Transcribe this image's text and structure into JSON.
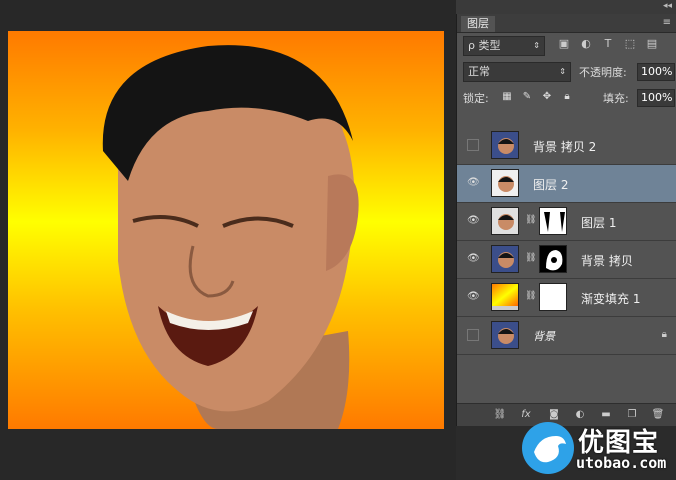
{
  "panel": {
    "collapse_icon": "double-chevron-icon",
    "tab_label": "图层",
    "filter": {
      "label": "ρ 类型"
    },
    "blend_mode": "正常",
    "opacity_label": "不透明度:",
    "opacity_value": "100%",
    "lock_label": "锁定:",
    "fill_label": "填充:",
    "fill_value": "100%"
  },
  "layers": [
    {
      "name": "背景 拷贝 2",
      "visible": false,
      "has_mask": false
    },
    {
      "name": "图层 2",
      "visible": true,
      "selected": true,
      "has_mask": false
    },
    {
      "name": "图层 1",
      "visible": true,
      "has_mask": true
    },
    {
      "name": "背景 拷贝",
      "visible": true,
      "has_mask": true
    },
    {
      "name": "渐变填充 1",
      "visible": true,
      "has_mask": true
    },
    {
      "name": "背景",
      "visible": false,
      "locked": true
    }
  ],
  "watermark": {
    "text": "优图宝",
    "url": "utobao.com"
  },
  "colors": {
    "accent": "#6f8397",
    "canvas_orange": "#ff7a00",
    "canvas_yellow": "#ffff00"
  }
}
